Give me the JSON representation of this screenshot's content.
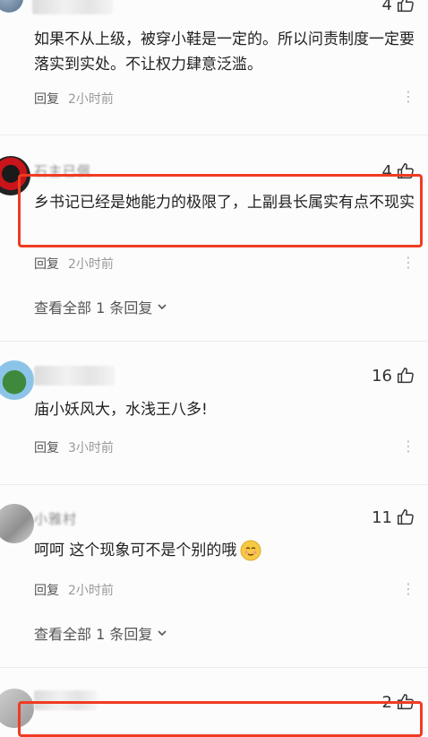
{
  "comments": [
    {
      "likes": "4",
      "text": "如果不从上级，被穿小鞋是一定的。所以问责制度一定要落实到实处。不让权力肆意泛滥。",
      "reply_label": "回复",
      "time": "2小时前"
    },
    {
      "user_name": "石主已佩",
      "likes": "4",
      "text": "乡书记已经是她能力的极限了，上副县长属实有点不现实",
      "reply_label": "回复",
      "time": "2小时前",
      "view_all": "查看全部 1 条回复"
    },
    {
      "likes": "16",
      "text": "庙小妖风大，水浅王八多!",
      "reply_label": "回复",
      "time": "3小时前"
    },
    {
      "user_name": "小雅村",
      "likes": "11",
      "text": "呵呵 这个现象可不是个别的哦",
      "reply_label": "回复",
      "time": "2小时前",
      "view_all": "查看全部 1 条回复"
    },
    {
      "likes": "2"
    }
  ],
  "colors": {
    "highlight": "#f03b22",
    "emoji": "#f6c945"
  },
  "icons": [
    "thumb-up-icon",
    "more-icon",
    "chevron-down-icon",
    "emoji-icon"
  ]
}
